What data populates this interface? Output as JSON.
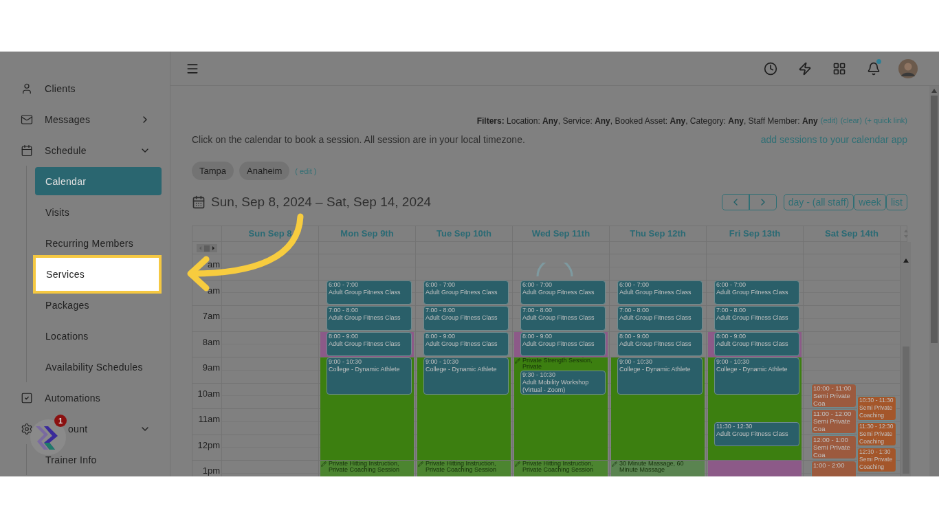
{
  "sidebar": {
    "items": [
      {
        "label": "Clients"
      },
      {
        "label": "Messages",
        "expanded": false
      },
      {
        "label": "Schedule",
        "expanded": true,
        "children": [
          {
            "label": "Calendar",
            "selected": true,
            "highlighted": false
          },
          {
            "label": "Visits",
            "selected": false,
            "highlighted": false
          },
          {
            "label": "Recurring Members",
            "selected": false,
            "highlighted": false
          },
          {
            "label": "Services",
            "selected": false,
            "highlighted": true
          },
          {
            "label": "Packages",
            "selected": false,
            "highlighted": false
          },
          {
            "label": "Locations",
            "selected": false,
            "highlighted": false
          },
          {
            "label": "Availability Schedules",
            "selected": false,
            "highlighted": false
          }
        ]
      },
      {
        "label": "Automations"
      },
      {
        "label": "ount",
        "expanded": true,
        "children": [
          {
            "label": "Trainer Info",
            "selected": false,
            "highlighted": false
          }
        ]
      }
    ]
  },
  "helper_badge": {
    "count": "1"
  },
  "filters": {
    "text": "**Filters:** Location: **Any**, Service: **Any**, Booked Asset: **Any**, Category: **Any**, Staff Member: **Any**",
    "links": [
      "(edit)",
      "(clear)",
      "(+ quick link)"
    ]
  },
  "intro": "Click on the calendar to book a session. All session are in your local timezone.",
  "calendar_app_link": "add sessions to your calendar app",
  "locations": {
    "chips": [
      "Tampa",
      "Anaheim"
    ],
    "edit": "( edit )"
  },
  "calendar": {
    "date_range": "Sun, Sep 8, 2024 – Sat, Sep 14, 2024",
    "views": [
      "day - (all staff)",
      "week",
      "list"
    ],
    "hours": [
      "am",
      "am",
      "7am",
      "8am",
      "9am",
      "10am",
      "11am",
      "12pm",
      "1pm"
    ],
    "days": [
      {
        "label": "Sun Sep 8",
        "shading": [
          {
            "kind": "free"
          },
          {
            "kind": "free"
          },
          {
            "kind": "free"
          },
          {
            "kind": "free"
          },
          {
            "kind": "free"
          },
          {
            "kind": "free"
          },
          {
            "kind": "free"
          },
          {
            "kind": "free"
          },
          {
            "kind": "free"
          }
        ]
      },
      {
        "label": "Mon Sep 9th",
        "shading": [
          {
            "kind": "free"
          },
          {
            "kind": "free"
          },
          {
            "kind": "free"
          },
          {
            "kind": "booked"
          },
          {
            "kind": "open"
          },
          {
            "kind": "open"
          },
          {
            "kind": "open"
          },
          {
            "kind": "open"
          },
          {
            "kind": "soft",
            "label": "Private Hitting Instruction, Private Coaching Session"
          }
        ],
        "events": [
          {
            "time": "6:00 - 7:00",
            "title": "Adult Group Fitness Class",
            "color": "#2a5f69",
            "kind": "full"
          },
          {
            "time": "7:00 - 8:00",
            "title": "Adult Group Fitness Class",
            "color": "#2a5f69",
            "kind": "full"
          },
          {
            "time": "8:00 - 9:00",
            "title": "Adult Group Fitness Class",
            "color": "#2a5f69",
            "kind": "full"
          },
          {
            "time": "9:00 - 10:30",
            "title": "College - Dynamic Athlete",
            "color": "#2a5f69",
            "kind": "full"
          }
        ]
      },
      {
        "label": "Tue Sep 10th",
        "shading": [
          {
            "kind": "free"
          },
          {
            "kind": "free"
          },
          {
            "kind": "free"
          },
          {
            "kind": "free"
          },
          {
            "kind": "open"
          },
          {
            "kind": "open"
          },
          {
            "kind": "open"
          },
          {
            "kind": "open"
          },
          {
            "kind": "soft",
            "label": "Private Hitting Instruction, Private Coaching Session"
          }
        ],
        "events": [
          {
            "time": "6:00 - 7:00",
            "title": "Adult Group Fitness Class",
            "color": "#2a5f69",
            "kind": "full"
          },
          {
            "time": "7:00 - 8:00",
            "title": "Adult Group Fitness Class",
            "color": "#2a5f69",
            "kind": "full"
          },
          {
            "time": "8:00 - 9:00",
            "title": "Adult Group Fitness Class",
            "color": "#2a5f69",
            "kind": "full"
          },
          {
            "time": "9:00 - 10:30",
            "title": "College - Dynamic Athlete",
            "color": "#2a5f69",
            "kind": "full"
          }
        ]
      },
      {
        "label": "Wed Sep 11th",
        "shading": [
          {
            "kind": "free"
          },
          {
            "kind": "free"
          },
          {
            "kind": "free"
          },
          {
            "kind": "booked"
          },
          {
            "kind": "open",
            "label": "Private Strength Session, Private"
          },
          {
            "kind": "open"
          },
          {
            "kind": "open"
          },
          {
            "kind": "open"
          },
          {
            "kind": "soft",
            "label": "Private Hitting Instruction, Private Coaching Session"
          }
        ],
        "events": [
          {
            "time": "6:00 - 7:00",
            "title": "Adult Group Fitness Class",
            "color": "#2a5f69",
            "kind": "full"
          },
          {
            "time": "7:00 - 8:00",
            "title": "Adult Group Fitness Class",
            "color": "#2a5f69",
            "kind": "full"
          },
          {
            "time": "8:00 - 9:00",
            "title": "Adult Group Fitness Class",
            "color": "#2a5f69",
            "kind": "full"
          },
          {
            "time": "9:30 - 10:30",
            "title": "Adult Mobility Workshop (Virtual - Zoom)",
            "color": "#2a5f69",
            "kind": "full"
          }
        ]
      },
      {
        "label": "Thu Sep 12th",
        "shading": [
          {
            "kind": "free"
          },
          {
            "kind": "free"
          },
          {
            "kind": "free"
          },
          {
            "kind": "free"
          },
          {
            "kind": "open"
          },
          {
            "kind": "open"
          },
          {
            "kind": "open"
          },
          {
            "kind": "open"
          },
          {
            "kind": "massage",
            "label": "30 Minute Massage, 60 Minute Massage"
          }
        ],
        "events": [
          {
            "time": "6:00 - 7:00",
            "title": "Adult Group Fitness Class",
            "color": "#2a5f69",
            "kind": "full"
          },
          {
            "time": "7:00 - 8:00",
            "title": "Adult Group Fitness Class",
            "color": "#2a5f69",
            "kind": "full"
          },
          {
            "time": "8:00 - 9:00",
            "title": "Adult Group Fitness Class",
            "color": "#2a5f69",
            "kind": "full"
          },
          {
            "time": "9:00 - 10:30",
            "title": "College - Dynamic Athlete",
            "color": "#2a5f69",
            "kind": "full"
          }
        ]
      },
      {
        "label": "Fri Sep 13th",
        "shading": [
          {
            "kind": "free"
          },
          {
            "kind": "free"
          },
          {
            "kind": "free"
          },
          {
            "kind": "booked"
          },
          {
            "kind": "open"
          },
          {
            "kind": "open"
          },
          {
            "kind": "open"
          },
          {
            "kind": "open"
          },
          {
            "kind": "booked"
          }
        ],
        "events": [
          {
            "time": "6:00 - 7:00",
            "title": "Adult Group Fitness Class",
            "color": "#2a5f69",
            "kind": "full"
          },
          {
            "time": "7:00 - 8:00",
            "title": "Adult Group Fitness Class",
            "color": "#2a5f69",
            "kind": "full"
          },
          {
            "time": "8:00 - 9:00",
            "title": "Adult Group Fitness Class",
            "color": "#2a5f69",
            "kind": "full"
          },
          {
            "time": "9:00 - 10:30",
            "title": "College - Dynamic Athlete",
            "color": "#2a5f69",
            "kind": "full"
          },
          {
            "time": "11:30 - 12:30",
            "title": "Adult Group Fitness Class",
            "color": "#2a5f69",
            "kind": "full"
          }
        ]
      },
      {
        "label": "Sat Sep 14th",
        "shading": [
          {
            "kind": "free"
          },
          {
            "kind": "free"
          },
          {
            "kind": "free"
          },
          {
            "kind": "free"
          },
          {
            "kind": "free"
          },
          {
            "kind": "free"
          },
          {
            "kind": "free"
          },
          {
            "kind": "free"
          },
          {
            "kind": "free"
          }
        ],
        "events": [
          {
            "time": "10:00 - 11:00",
            "title": "Semi Private Coa",
            "color": "#9c5a3e",
            "kind": "left"
          },
          {
            "time": "10:30 - 11:30",
            "title": "Semi Private Coaching",
            "color": "#a4562a",
            "kind": "right"
          },
          {
            "time": "11:00 - 12:00",
            "title": "Semi Private Coa",
            "color": "#9c5a3e",
            "kind": "left"
          },
          {
            "time": "11:30 - 12:30",
            "title": "Semi Private Coaching",
            "color": "#a4562a",
            "kind": "right"
          },
          {
            "time": "12:00 - 1:00",
            "title": "Semi Private Coa",
            "color": "#9c5a3e",
            "kind": "left"
          },
          {
            "time": "1:00 - 2:00",
            "color": "#9c5a3e",
            "kind": "left"
          },
          {
            "time": "12:30 - 1:30",
            "title": "Semi Private Coaching",
            "color": "#a4562a",
            "kind": "right"
          }
        ]
      }
    ]
  }
}
